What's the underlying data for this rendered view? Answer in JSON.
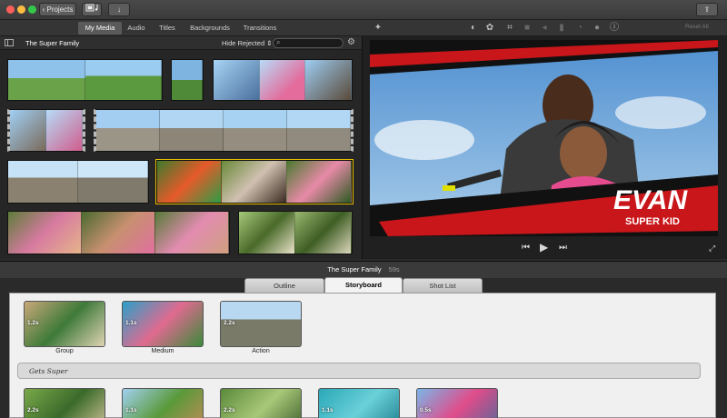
{
  "window": {
    "projects_label": "Projects",
    "reset_all_label": "Reset All"
  },
  "library_tabs": [
    "My Media",
    "Audio",
    "Titles",
    "Backgrounds",
    "Transitions"
  ],
  "browser": {
    "event_title": "The Super Family",
    "filter_label": "Hide Rejected"
  },
  "viewer": {
    "title_main": "EVAN",
    "title_sub": "SUPER KID"
  },
  "project": {
    "name": "The Super Family",
    "duration": "59s",
    "tabs": [
      "Outline",
      "Storyboard",
      "Shot List"
    ],
    "active_tab": "Storyboard",
    "section_name": "Gets Super",
    "row1": [
      {
        "duration": "1.2s",
        "label": "Group"
      },
      {
        "duration": "1.1s",
        "label": "Medium"
      },
      {
        "duration": "2.2s",
        "label": "Action"
      }
    ],
    "row2": [
      {
        "duration": "2.2s"
      },
      {
        "duration": "1.1s"
      },
      {
        "duration": "2.2s"
      },
      {
        "duration": "1.1s"
      },
      {
        "duration": "0.5s"
      }
    ]
  }
}
